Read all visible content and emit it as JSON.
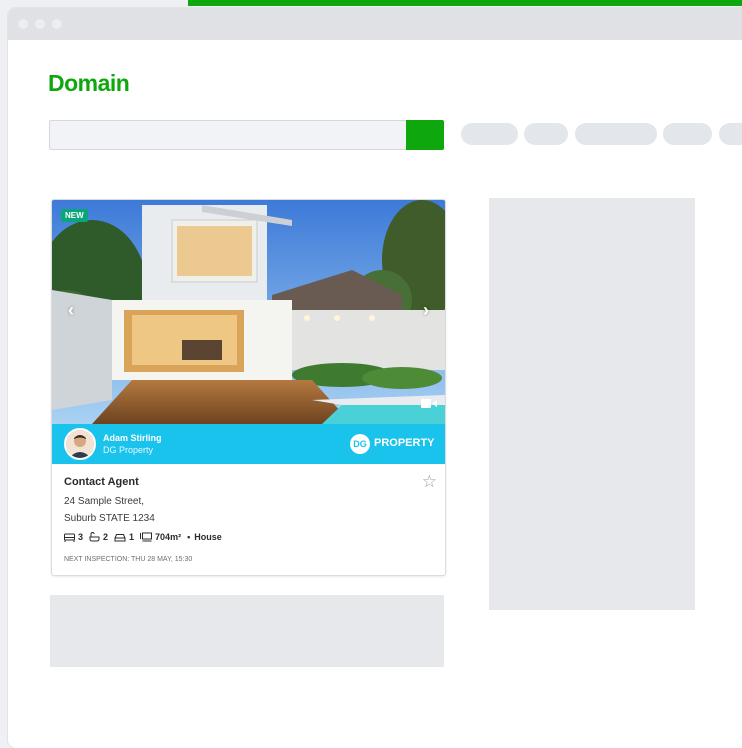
{
  "window": {
    "logo": "Domain"
  },
  "search": {
    "placeholder": ""
  },
  "listing": {
    "badge": "NEW",
    "agent_name": "Adam Stirling",
    "agency": "DG Property",
    "brand_mark": "DG",
    "brand_text": "PROPERTY",
    "price": "Contact Agent",
    "address_line1": "24 Sample Street,",
    "address_line2": "Suburb STATE 1234",
    "beds": "3",
    "baths": "2",
    "parking": "1",
    "land": "704m²",
    "separator": "•",
    "type": "House",
    "inspection": "NEXT INSPECTION: THU 28 MAY, 15:30"
  },
  "colors": {
    "brand_green": "#0ea80e",
    "agent_bar": "#19c3ec",
    "badge_new": "#0aa67a"
  },
  "icons": [
    "prev-arrow-icon",
    "next-arrow-icon",
    "video-icon",
    "star-icon",
    "bed-icon",
    "bath-icon",
    "car-icon",
    "land-size-icon"
  ]
}
